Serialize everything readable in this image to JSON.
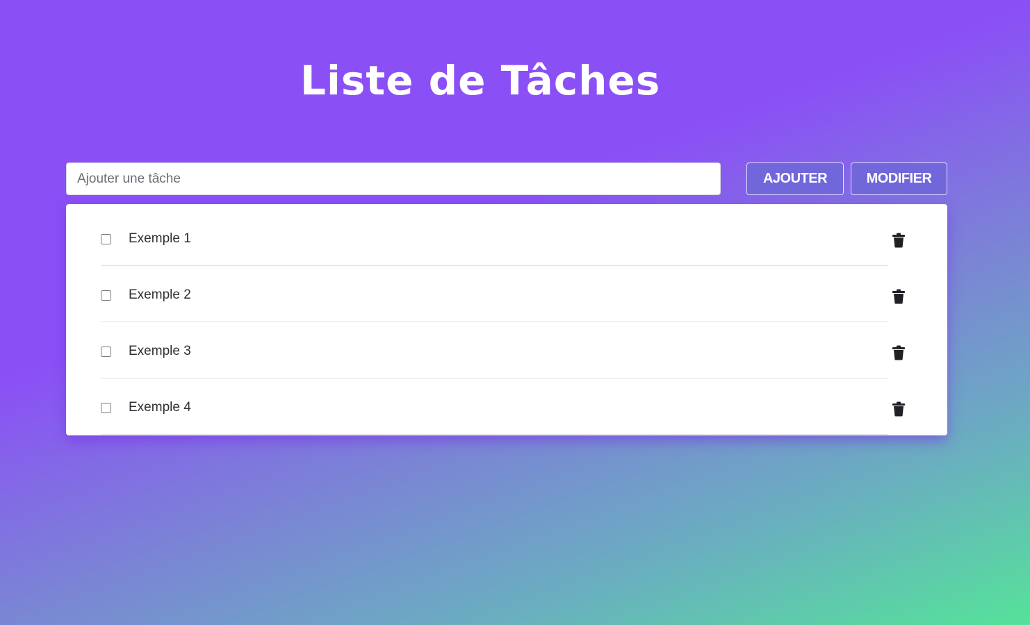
{
  "header": {
    "title": "Liste de Tâches"
  },
  "form": {
    "input_placeholder": "Ajouter une tâche",
    "input_value": "",
    "add_label": "AJOUTER",
    "edit_label": "MODIFIER"
  },
  "tasks": [
    {
      "label": "Exemple 1",
      "checked": false,
      "icon": "trash-icon"
    },
    {
      "label": "Exemple 2",
      "checked": false,
      "icon": "trash-icon"
    },
    {
      "label": "Exemple 3",
      "checked": false,
      "icon": "trash-icon"
    },
    {
      "label": "Exemple 4",
      "checked": false,
      "icon": "trash-icon"
    }
  ],
  "colors": {
    "gradient_start": "#8b4ff6",
    "gradient_end": "#55e29a",
    "button_bg": "#7166da",
    "text": "#2f2f34"
  }
}
